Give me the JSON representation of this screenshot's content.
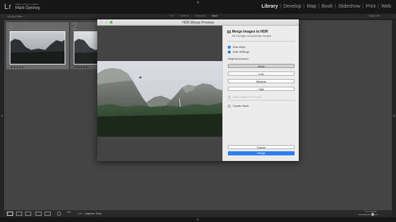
{
  "app": {
    "logo": "Lr",
    "identity_line1": "Adobe Lightroom Classic",
    "identity_line2": "Mark Denney"
  },
  "modules": [
    {
      "label": "Library",
      "active": true
    },
    {
      "label": "Develop",
      "active": false
    },
    {
      "label": "Map",
      "active": false
    },
    {
      "label": "Book",
      "active": false
    },
    {
      "label": "Slideshow",
      "active": false
    },
    {
      "label": "Print",
      "active": false
    },
    {
      "label": "Web",
      "active": false
    }
  ],
  "filter_bar": {
    "title": "Library Filter :",
    "options": [
      {
        "label": "Text",
        "active": false
      },
      {
        "label": "Attribute",
        "active": false
      },
      {
        "label": "Metadata",
        "active": false
      },
      {
        "label": "None",
        "active": true
      }
    ],
    "filters_off": "Filters Off"
  },
  "grid": {
    "cells": [
      {
        "number": "1",
        "stars": "★★★★★",
        "selected": true
      },
      {
        "number": "2",
        "stars": "★★★★★",
        "selected": false
      }
    ]
  },
  "toolbar": {
    "sort_label": "Sort:",
    "sort_value": "Capture Time",
    "thumbnails_label": "Thumbnails"
  },
  "dialog": {
    "title": "HDR Merge Preview",
    "panel_title": "Merge Images to HDR",
    "status": "All 3 images successfully merged",
    "auto_align": {
      "label": "Auto Align",
      "checked": true
    },
    "auto_settings": {
      "label": "Auto Settings",
      "checked": true
    },
    "deghost_label": "Deghost Amount",
    "deghost_options": [
      {
        "label": "None",
        "selected": true
      },
      {
        "label": "Low",
        "selected": false
      },
      {
        "label": "Medium",
        "selected": false
      },
      {
        "label": "High",
        "selected": false
      }
    ],
    "show_overlay": {
      "label": "Show Deghost Overlay",
      "checked": false
    },
    "create_stack": {
      "label": "Create Stack",
      "checked": false
    },
    "cancel_label": "Cancel",
    "merge_label": "Merge"
  },
  "colors": {
    "accent": "#2f7ff0",
    "checkbox": "#3c7de6",
    "zoom_light": "#4fbf44"
  }
}
